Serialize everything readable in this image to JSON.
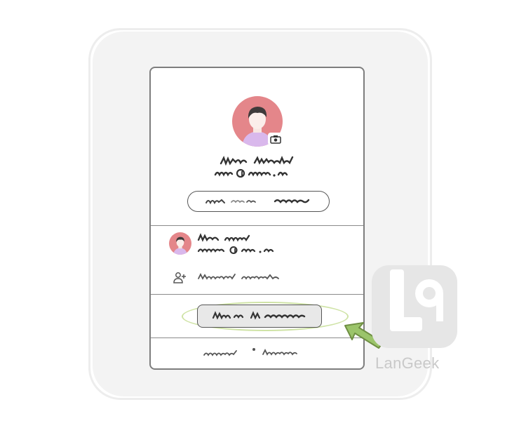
{
  "profile": {
    "avatar_icon": "user-avatar",
    "camera_icon": "camera-icon"
  },
  "accounts": {
    "add_account_icon": "add-person-icon"
  },
  "watermark": {
    "brand_name": "LanGeek"
  },
  "colors": {
    "avatar_bg": "#e4868a",
    "highlight_ring": "#cfe3a6",
    "pointer_arrow": "#9bc46a",
    "card_border": "#7d7d7d",
    "backdrop": "#f3f3f3"
  }
}
